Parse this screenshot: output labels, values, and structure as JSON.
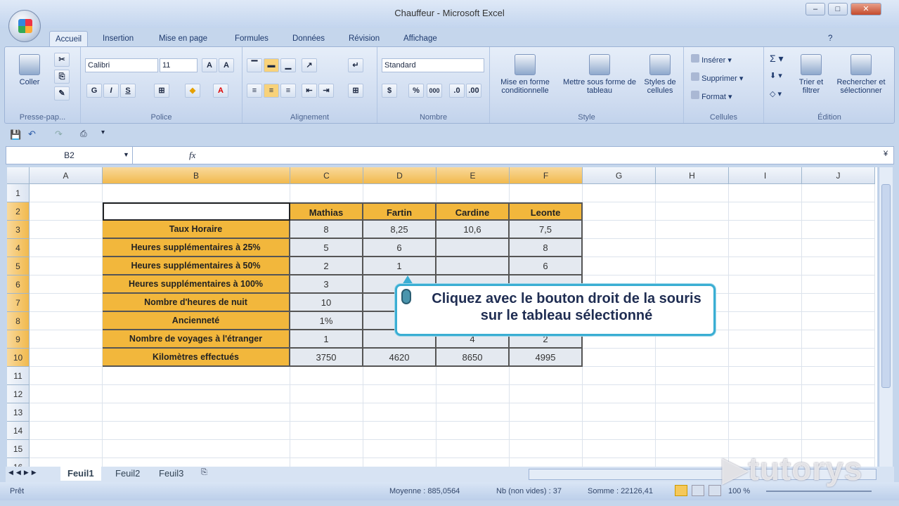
{
  "window": {
    "title": "Chauffeur - Microsoft Excel"
  },
  "tabs": [
    "Accueil",
    "Insertion",
    "Mise en page",
    "Formules",
    "Données",
    "Révision",
    "Affichage"
  ],
  "ribbon": {
    "clipboard": {
      "paste": "Coller",
      "label": "Presse-pap..."
    },
    "font": {
      "name": "Calibri",
      "size": "11",
      "bold": "G",
      "italic": "I",
      "underline": "S",
      "label": "Police"
    },
    "alignment": {
      "label": "Alignement"
    },
    "number": {
      "format": "Standard",
      "percent": "%",
      "thousands": "000",
      "label": "Nombre"
    },
    "style": {
      "conditional": "Mise en forme conditionnelle",
      "table": "Mettre sous forme de tableau",
      "cell_styles": "Styles de cellules",
      "label": "Style"
    },
    "cells": {
      "insert": "Insérer",
      "delete": "Supprimer",
      "format": "Format",
      "label": "Cellules"
    },
    "editing": {
      "sort": "Trier et filtrer",
      "find": "Rechercher et sélectionner",
      "label": "Édition"
    }
  },
  "formula_bar": {
    "name_box": "B2",
    "fx": "fx",
    "value": ""
  },
  "columns": [
    "A",
    "B",
    "C",
    "D",
    "E",
    "F",
    "G",
    "H",
    "I",
    "J"
  ],
  "selected_columns": [
    "B",
    "C",
    "D",
    "E",
    "F"
  ],
  "rows": [
    "1",
    "2",
    "3",
    "4",
    "5",
    "6",
    "7",
    "8",
    "9",
    "10",
    "11",
    "12",
    "13",
    "14",
    "15",
    "16"
  ],
  "table": {
    "headers": [
      "Mathias",
      "Fartin",
      "Cardine",
      "Leonte"
    ],
    "rows": [
      {
        "label": "Taux Horaire",
        "values": [
          "8",
          "8,25",
          "10,6",
          "7,5"
        ]
      },
      {
        "label": "Heures supplémentaires à 25%",
        "values": [
          "5",
          "6",
          "",
          "8"
        ]
      },
      {
        "label": "Heures supplémentaires à 50%",
        "values": [
          "2",
          "1",
          "",
          "6"
        ]
      },
      {
        "label": "Heures supplémentaires à 100%",
        "values": [
          "3",
          "",
          "",
          ""
        ]
      },
      {
        "label": "Nombre d'heures de nuit",
        "values": [
          "10",
          "",
          "",
          ""
        ]
      },
      {
        "label": "Ancienneté",
        "values": [
          "1%",
          "",
          "",
          ""
        ]
      },
      {
        "label": "Nombre de voyages à l'étranger",
        "values": [
          "1",
          "",
          "4",
          "2"
        ]
      },
      {
        "label": "Kilomètres effectués",
        "values": [
          "3750",
          "4620",
          "8650",
          "4995"
        ]
      }
    ]
  },
  "callout": {
    "text": "Cliquez avec le bouton droit de la souris sur le tableau sélectionné"
  },
  "sheets": [
    "Feuil1",
    "Feuil2",
    "Feuil3"
  ],
  "active_sheet": "Feuil1",
  "status": {
    "ready": "Prêt",
    "average": "Moyenne : 885,0564",
    "count": "Nb (non vides) : 37",
    "sum": "Somme : 22126,41",
    "zoom": "100 %"
  },
  "watermark": "tutorys",
  "colors": {
    "header_fill": "#f2b73c",
    "value_fill": "#e4e9f0",
    "callout_border": "#3aaed3"
  }
}
